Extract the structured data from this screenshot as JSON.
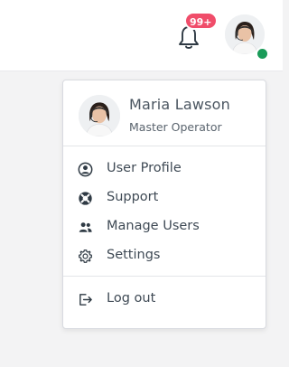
{
  "header": {
    "notifications": {
      "badge": "99+",
      "icon": "bell-icon"
    },
    "avatar": {
      "status_color": "#1a9b59",
      "status": "online"
    }
  },
  "menu": {
    "user": {
      "name": "Maria Lawson",
      "role": "Master Operator"
    },
    "items": [
      {
        "label": "User Profile",
        "icon": "user-circle-icon"
      },
      {
        "label": "Support",
        "icon": "lifebuoy-icon"
      },
      {
        "label": "Manage Users",
        "icon": "users-icon"
      },
      {
        "label": "Settings",
        "icon": "gear-icon"
      }
    ],
    "logout": {
      "label": "Log out",
      "icon": "logout-icon"
    }
  },
  "colors": {
    "badge": "#f04d6a",
    "status": "#1a9b59",
    "text": "#3f4a55"
  }
}
